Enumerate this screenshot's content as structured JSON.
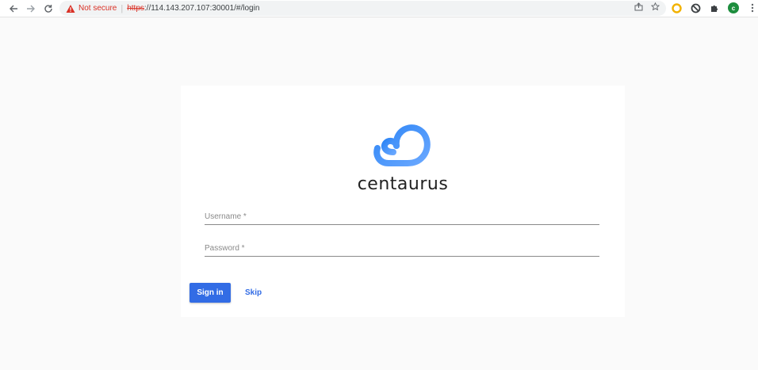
{
  "browser": {
    "security_label": "Not secure",
    "url_scheme": "https",
    "url_rest": "://114.143.207.107:30001/#/login",
    "profile_initial": "c",
    "icons": [
      "back-icon",
      "forward-icon",
      "reload-icon",
      "warning-icon",
      "share-icon",
      "star-icon",
      "extension-ring-icon",
      "block-icon",
      "puzzle-icon",
      "menu-icon"
    ]
  },
  "login": {
    "brand": "centaurus",
    "username_placeholder": "Username *",
    "password_placeholder": "Password *",
    "signin_label": "Sign in",
    "skip_label": "Skip"
  },
  "colors": {
    "accent": "#326ce5",
    "logo_gradient_start": "#2f86f6",
    "logo_gradient_end": "#6aa8ff",
    "warning": "#d93025",
    "page_bg": "#fafafa"
  }
}
